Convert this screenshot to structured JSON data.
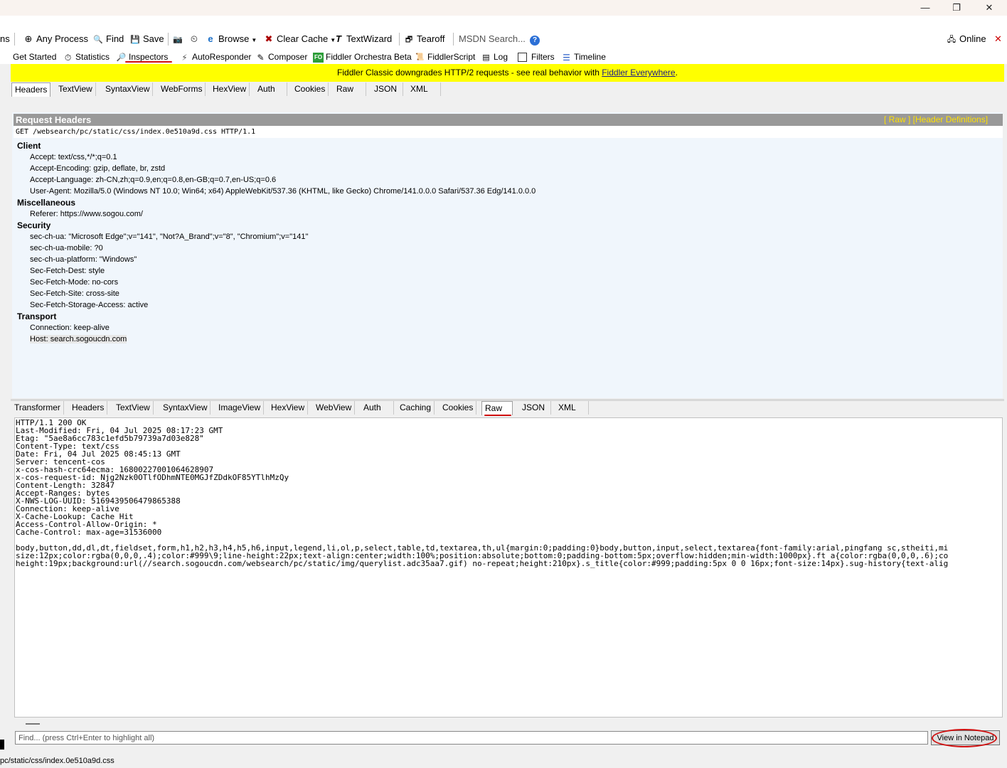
{
  "window": {
    "minimize": "—",
    "maximize": "❐",
    "close": "✕"
  },
  "toolbar": {
    "partial_left": "ns",
    "any_process": "Any Process",
    "find": "Find",
    "save": "Save",
    "browse": "Browse",
    "clear_cache": "Clear Cache",
    "textwizard": "TextWizard",
    "tearoff": "Tearoff",
    "msdn_search": "MSDN Search...",
    "online": "Online"
  },
  "tabs": [
    "Get Started",
    "Statistics",
    "Inspectors",
    "AutoResponder",
    "Composer",
    "Fiddler Orchestra Beta",
    "FiddlerScript",
    "Log",
    "Filters",
    "Timeline"
  ],
  "tab_icon_fo": "FO",
  "banner": {
    "text": "Fiddler Classic downgrades HTTP/2 requests - see real behavior with ",
    "link": "Fiddler Everywhere",
    "suffix": "."
  },
  "request_tabs": [
    "Headers",
    "TextView",
    "SyntaxView",
    "WebForms",
    "HexView",
    "Auth",
    "Cookies",
    "Raw",
    "JSON",
    "XML"
  ],
  "request_panel": {
    "title": "Request Headers",
    "links": "[ Raw ]   [Header Definitions]",
    "request_line": "GET /websearch/pc/static/css/index.0e510a9d.css HTTP/1.1",
    "groups": [
      {
        "name": "Client",
        "headers": [
          "Accept: text/css,*/*;q=0.1",
          "Accept-Encoding: gzip, deflate, br, zstd",
          "Accept-Language: zh-CN,zh;q=0.9,en;q=0.8,en-GB;q=0.7,en-US;q=0.6",
          "User-Agent: Mozilla/5.0 (Windows NT 10.0; Win64; x64) AppleWebKit/537.36 (KHTML, like Gecko) Chrome/141.0.0.0 Safari/537.36 Edg/141.0.0.0"
        ]
      },
      {
        "name": "Miscellaneous",
        "headers": [
          "Referer: https://www.sogou.com/"
        ]
      },
      {
        "name": "Security",
        "headers": [
          "sec-ch-ua: \"Microsoft Edge\";v=\"141\", \"Not?A_Brand\";v=\"8\", \"Chromium\";v=\"141\"",
          "sec-ch-ua-mobile: ?0",
          "sec-ch-ua-platform: \"Windows\"",
          "Sec-Fetch-Dest: style",
          "Sec-Fetch-Mode: no-cors",
          "Sec-Fetch-Site: cross-site",
          "Sec-Fetch-Storage-Access: active"
        ]
      },
      {
        "name": "Transport",
        "headers": [
          "Connection: keep-alive",
          "Host: search.sogoucdn.com"
        ]
      }
    ]
  },
  "response_tabs": [
    "Transformer",
    "Headers",
    "TextView",
    "SyntaxView",
    "ImageView",
    "HexView",
    "WebView",
    "Auth",
    "Caching",
    "Cookies",
    "Raw",
    "JSON",
    "XML"
  ],
  "response_raw": [
    "HTTP/1.1 200 OK",
    "Last-Modified: Fri, 04 Jul 2025 08:17:23 GMT",
    "Etag: \"5ae8a6cc783c1efd5b79739a7d03e828\"",
    "Content-Type: text/css",
    "Date: Fri, 04 Jul 2025 08:45:13 GMT",
    "Server: tencent-cos",
    "x-cos-hash-crc64ecma: 16800227001064628907",
    "x-cos-request-id: Njg2Nzk0OTlfODhmNTE0MGJfZDdkOF85YTlhMzQy",
    "Content-Length: 32847",
    "Accept-Ranges: bytes",
    "X-NWS-LOG-UUID: 5169439506479865388",
    "Connection: keep-alive",
    "X-Cache-Lookup: Cache Hit",
    "Access-Control-Allow-Origin: *",
    "Cache-Control: max-age=31536000"
  ],
  "response_body": [
    "body,button,dd,dl,dt,fieldset,form,h1,h2,h3,h4,h5,h6,input,legend,li,ol,p,select,table,td,textarea,th,ul{margin:0;padding:0}body,button,input,select,textarea{font-family:arial,pingfang sc,stheiti,mi",
    "size:12px;color:rgba(0,0,0,.4);color:#999\\9;line-height:22px;text-align:center;width:100%;position:absolute;bottom:0;padding-bottom:5px;overflow:hidden;min-width:1000px}.ft a{color:rgba(0,0,0,.6);co",
    "height:19px;background:url(//search.sogoucdn.com/websearch/pc/static/img/querylist.adc35aa7.gif) no-repeat;height:210px}.s_title{color:#999;padding:5px 0 0 16px;font-size:14px}.sug-history{text-alig"
  ],
  "find": {
    "placeholder": "Find... (press Ctrl+Enter to highlight all)",
    "button": "View in Notepad"
  },
  "status": {
    "path": "pc/static/css/index.0e510a9d.css"
  }
}
